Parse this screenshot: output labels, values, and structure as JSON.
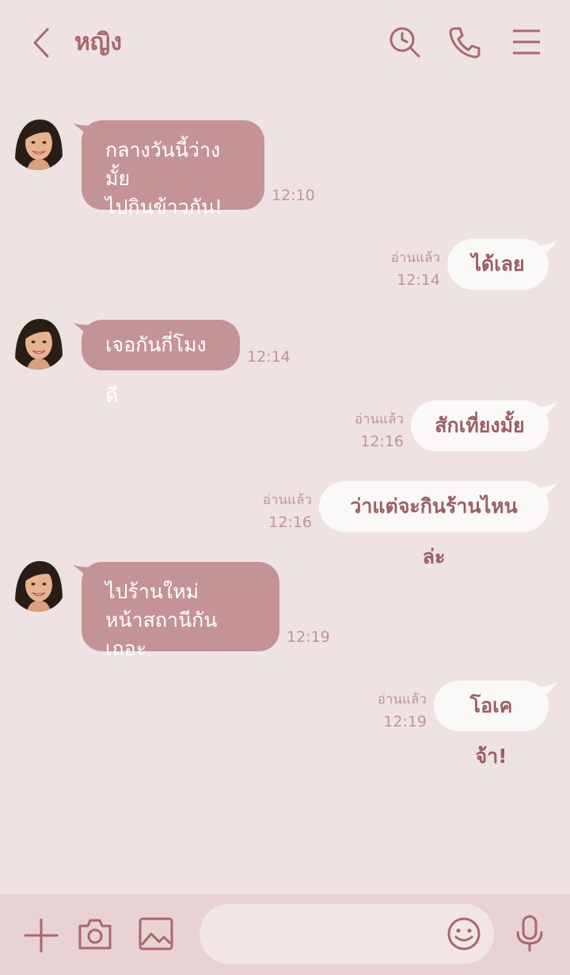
{
  "header": {
    "title": "หญิง",
    "back_icon": "chevron-left-icon",
    "search_icon": "search-history-icon",
    "call_icon": "phone-icon",
    "menu_icon": "hamburger-menu-icon"
  },
  "messages": [
    {
      "direction": "in",
      "lines": [
        "กลางวันนี้ว่างมั้ย",
        "ไปกินข้าวกัน!"
      ],
      "time": "12:10"
    },
    {
      "direction": "out",
      "text": "ได้เลย",
      "read": "อ่านแล้ว",
      "time": "12:14"
    },
    {
      "direction": "in",
      "lines": [
        "เจอกันกี่โมงดี"
      ],
      "time": "12:14"
    },
    {
      "direction": "out",
      "text": "สักเที่ยงมั้ย",
      "read": "อ่านแล้ว",
      "time": "12:16"
    },
    {
      "direction": "out",
      "text": "ว่าแต่จะกินร้านไหนล่ะ",
      "read": "อ่านแล้ว",
      "time": "12:16"
    },
    {
      "direction": "in",
      "lines": [
        "ไปร้านใหม่",
        "หน้าสถานีกันเถอะ"
      ],
      "time": "12:19"
    },
    {
      "direction": "out",
      "text": "โอเคจ้า!",
      "read": "อ่านแล้ว",
      "time": "12:19"
    }
  ],
  "footer": {
    "input_placeholder": "",
    "icons": [
      "plus-icon",
      "camera-icon",
      "image-icon",
      "emoji-icon",
      "microphone-icon"
    ]
  },
  "colors": {
    "background": "#efe2e3",
    "incoming_bubble": "#c49395",
    "outgoing_bubble": "#fbf8f8",
    "accent": "#a8686c",
    "footer": "#e8d2d4"
  }
}
